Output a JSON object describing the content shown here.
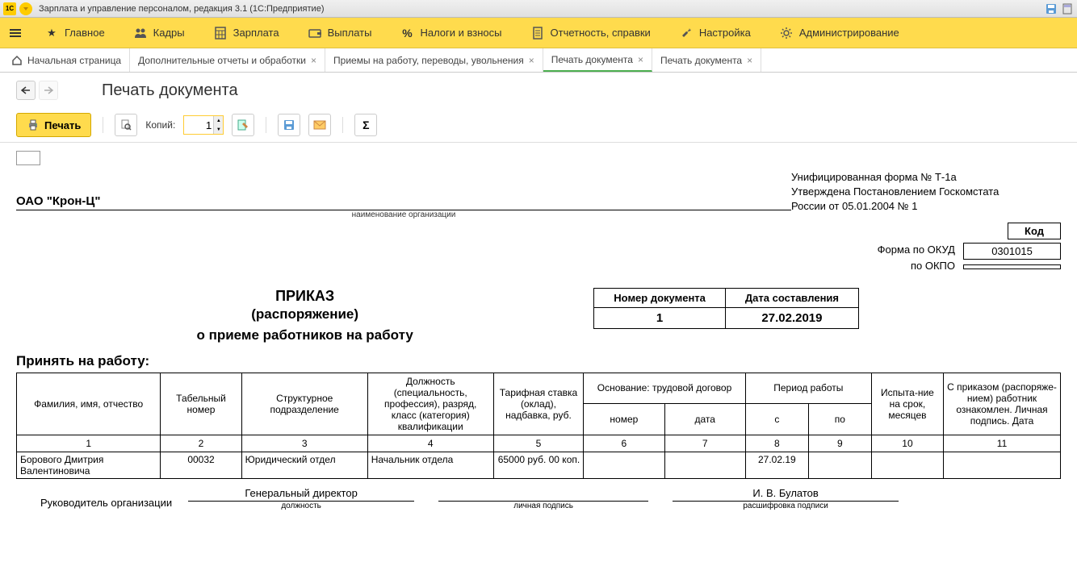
{
  "title_bar": {
    "app_icon_text": "1C",
    "title": "Зарплата и управление персоналом, редакция 3.1  (1С:Предприятие)"
  },
  "main_menu": {
    "items": [
      {
        "label": "Главное",
        "icon": "star"
      },
      {
        "label": "Кадры",
        "icon": "people"
      },
      {
        "label": "Зарплата",
        "icon": "calc"
      },
      {
        "label": "Выплаты",
        "icon": "wallet"
      },
      {
        "label": "Налоги и взносы",
        "icon": "percent"
      },
      {
        "label": "Отчетность, справки",
        "icon": "report"
      },
      {
        "label": "Настройка",
        "icon": "wrench"
      },
      {
        "label": "Администрирование",
        "icon": "gear"
      }
    ]
  },
  "tabs": [
    {
      "label": "Начальная страница",
      "closable": false,
      "icon": "home"
    },
    {
      "label": "Дополнительные отчеты и обработки",
      "closable": true
    },
    {
      "label": "Приемы на работу, переводы, увольнения",
      "closable": true
    },
    {
      "label": "Печать документа",
      "closable": true,
      "active": true
    },
    {
      "label": "Печать документа",
      "closable": true
    }
  ],
  "page": {
    "title": "Печать документа"
  },
  "toolbar": {
    "print_label": "Печать",
    "copies_label": "Копий:",
    "copies_value": "1"
  },
  "document": {
    "form_header": {
      "line1": "Унифицированная форма № Т-1а",
      "line2": "Утверждена Постановлением Госкомстата",
      "line3": "России от 05.01.2004 № 1"
    },
    "code_block": {
      "header": "Код",
      "okud_label": "Форма по ОКУД",
      "okud_value": "0301015",
      "okpo_label": "по ОКПО",
      "okpo_value": ""
    },
    "org_name": "ОАО \"Крон-Ц\"",
    "org_caption": "наименование организации",
    "order": {
      "title1": "ПРИКАЗ",
      "title2": "(распоряжение)",
      "title3": "о приеме работников на работу",
      "doc_num_h": "Номер документа",
      "doc_date_h": "Дата составления",
      "doc_num": "1",
      "doc_date": "27.02.2019"
    },
    "accept_label": "Принять на работу:",
    "table": {
      "headers": {
        "fio": "Фамилия, имя, отчество",
        "tab_num": "Табельный номер",
        "dept": "Структурное подразделение",
        "position": "Должность (специальность, профессия), разряд, класс (категория) квалификации",
        "rate": "Тарифная ставка (оклад), надбавка, руб.",
        "basis": "Основание: трудовой договор",
        "basis_num": "номер",
        "basis_date": "дата",
        "period": "Период работы",
        "period_from": "с",
        "period_to": "по",
        "trial": "Испыта-ние на срок, месяцев",
        "sign": "С приказом (распоряже-нием) работник ознакомлен. Личная подпись. Дата"
      },
      "col_nums": [
        "1",
        "2",
        "3",
        "4",
        "5",
        "6",
        "7",
        "8",
        "9",
        "10",
        "11"
      ],
      "rows": [
        {
          "fio": "Борового Дмитрия Валентиновича",
          "tab_num": "00032",
          "dept": "Юридический отдел",
          "position": "Начальник отдела",
          "rate": "65000 руб. 00 коп.",
          "basis_num": "",
          "basis_date": "",
          "period_from": "27.02.19",
          "period_to": "",
          "trial": "",
          "sign": ""
        }
      ]
    },
    "signature": {
      "label": "Руководитель организации",
      "position": "Генеральный директор",
      "position_cap": "должность",
      "sign_cap": "личная подпись",
      "name": "И. В. Булатов",
      "name_cap": "расшифровка  подписи"
    }
  }
}
